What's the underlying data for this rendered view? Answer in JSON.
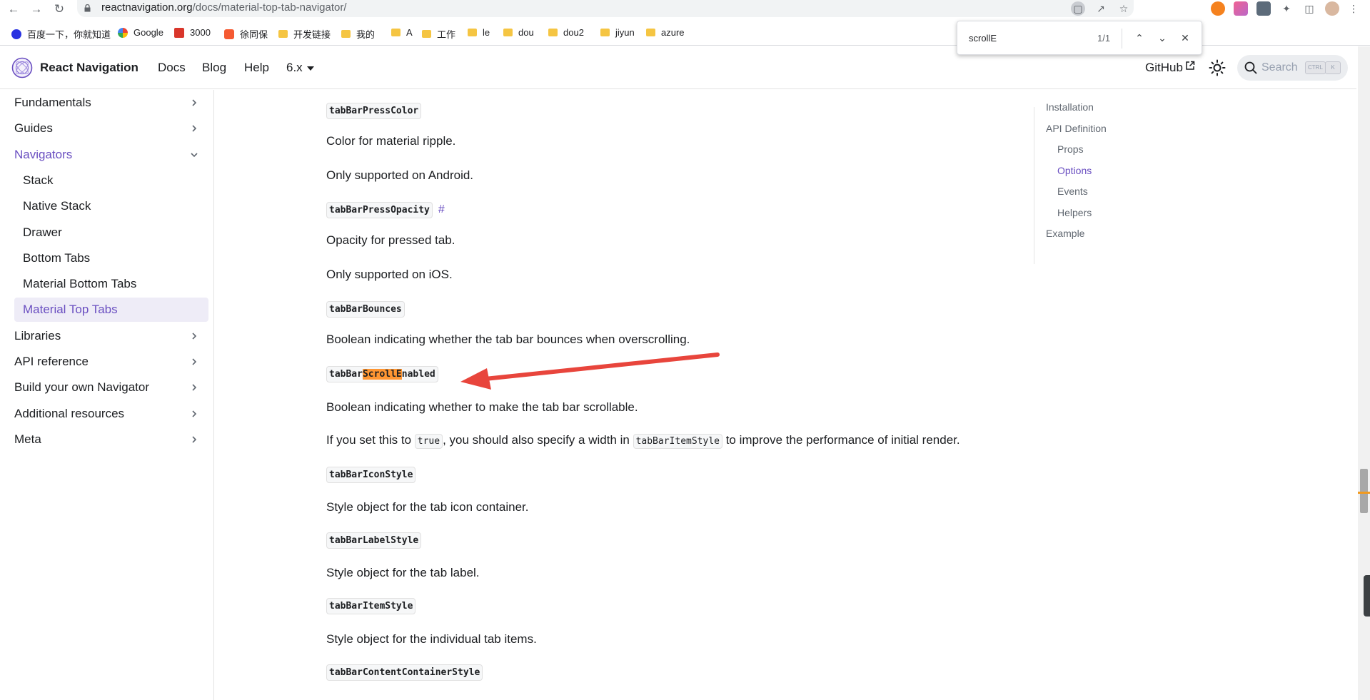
{
  "browser": {
    "url_host": "reactnavigation.org",
    "url_path": "/docs/material-top-tab-navigator/",
    "bookmarks": [
      {
        "label": "百度一下，你就知道",
        "icon": "baidu-paw-icon"
      },
      {
        "label": "Google",
        "icon": "google-g-icon"
      },
      {
        "label": "3000",
        "icon": "red-app-icon"
      },
      {
        "label": "徐同保",
        "icon": "csdn-c-icon"
      },
      {
        "label": "开发链接",
        "icon": "folder-icon"
      },
      {
        "label": "我的",
        "icon": "folder-icon"
      },
      {
        "label": "A",
        "icon": "folder-icon"
      },
      {
        "label": "工作",
        "icon": "folder-icon"
      },
      {
        "label": "le",
        "icon": "folder-icon"
      },
      {
        "label": "dou",
        "icon": "folder-icon"
      },
      {
        "label": "dou2",
        "icon": "folder-icon"
      },
      {
        "label": "jiyun",
        "icon": "folder-icon"
      },
      {
        "label": "azure",
        "icon": "folder-icon"
      }
    ]
  },
  "find": {
    "query": "scrollE",
    "count": "1/1"
  },
  "navbar": {
    "title": "React Navigation",
    "links": [
      "Docs",
      "Blog",
      "Help"
    ],
    "version": "6.x",
    "github": "GitHub",
    "search_placeholder": "Search",
    "kbd_ctrl": "CTRL",
    "kbd_k": "K"
  },
  "sidebar": {
    "items": [
      {
        "label": "Fundamentals",
        "expandable": true
      },
      {
        "label": "Guides",
        "expandable": true
      },
      {
        "label": "Navigators",
        "expandable": true,
        "expanded": true
      },
      {
        "label": "Stack",
        "sub": true
      },
      {
        "label": "Native Stack",
        "sub": true
      },
      {
        "label": "Drawer",
        "sub": true
      },
      {
        "label": "Bottom Tabs",
        "sub": true
      },
      {
        "label": "Material Bottom Tabs",
        "sub": true
      },
      {
        "label": "Material Top Tabs",
        "sub": true,
        "selected": true
      },
      {
        "label": "Libraries",
        "expandable": true
      },
      {
        "label": "API reference",
        "expandable": true
      },
      {
        "label": "Build your own Navigator",
        "expandable": true
      },
      {
        "label": "Additional resources",
        "expandable": true
      },
      {
        "label": "Meta",
        "expandable": true
      }
    ]
  },
  "content": {
    "press_color_code": "tabBarPressColor",
    "press_color_desc": "Color for material ripple.",
    "press_color_note": "Only supported on Android.",
    "press_opacity_code": "tabBarPressOpacity",
    "press_opacity_hash": "#",
    "press_opacity_desc": "Opacity for pressed tab.",
    "press_opacity_note": "Only supported on iOS.",
    "bounces_code": "tabBarBounces",
    "bounces_desc": "Boolean indicating whether the tab bar bounces when overscrolling.",
    "scroll_code_pre": "tabBar",
    "scroll_code_match": "ScrollE",
    "scroll_code_post": "nabled",
    "scroll_desc": "Boolean indicating whether to make the tab bar scrollable.",
    "scroll_note_1": "If you set this to ",
    "scroll_note_true": "true",
    "scroll_note_2": ", you should also specify a width in ",
    "scroll_note_item_style": "tabBarItemStyle",
    "scroll_note_3": " to improve the performance of initial render.",
    "icon_style_code": "tabBarIconStyle",
    "icon_style_desc": "Style object for the tab icon container.",
    "label_style_code": "tabBarLabelStyle",
    "label_style_desc": "Style object for the tab label.",
    "item_style_code": "tabBarItemStyle",
    "item_style_desc": "Style object for the individual tab items.",
    "content_container_code": "tabBarContentContainerStyle"
  },
  "toc": {
    "items": [
      {
        "label": "Installation",
        "level": 1
      },
      {
        "label": "API Definition",
        "level": 1
      },
      {
        "label": "Props",
        "level": 2
      },
      {
        "label": "Options",
        "level": 2,
        "active": true
      },
      {
        "label": "Events",
        "level": 2
      },
      {
        "label": "Helpers",
        "level": 2
      },
      {
        "label": "Example",
        "level": 1
      }
    ]
  },
  "colors": {
    "accent": "#6a4fc1",
    "find_highlight": "#ff9632",
    "arrow": "#e8453c"
  }
}
